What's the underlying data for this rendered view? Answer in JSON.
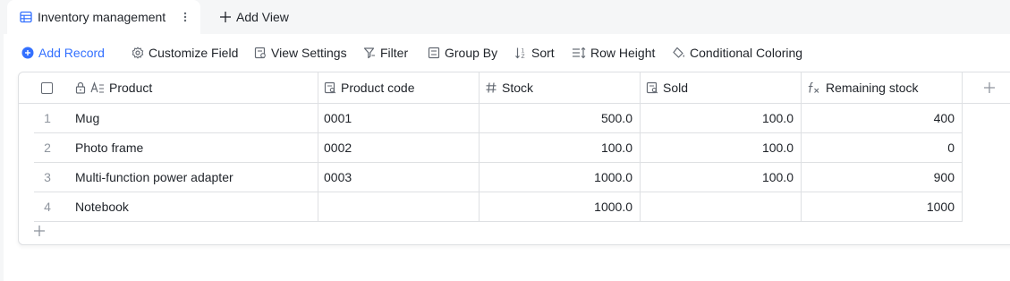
{
  "tabs": {
    "active_label": "Inventory management",
    "add_view_label": "Add View"
  },
  "toolbar": {
    "add_record": "Add Record",
    "customize_field": "Customize Field",
    "view_settings": "View Settings",
    "filter": "Filter",
    "group_by": "Group By",
    "sort": "Sort",
    "row_height": "Row Height",
    "conditional_coloring": "Conditional Coloring"
  },
  "table": {
    "columns": [
      "Product",
      "Product code",
      "Stock",
      "Sold",
      "Remaining stock"
    ],
    "rows": [
      {
        "index": "1",
        "product": "Mug",
        "code": "0001",
        "stock": "500.0",
        "sold": "100.0",
        "remaining": "400"
      },
      {
        "index": "2",
        "product": "Photo frame",
        "code": "0002",
        "stock": "100.0",
        "sold": "100.0",
        "remaining": "0"
      },
      {
        "index": "3",
        "product": "Multi-function power adapter",
        "code": "0003",
        "stock": "1000.0",
        "sold": "100.0",
        "remaining": "900"
      },
      {
        "index": "4",
        "product": "Notebook",
        "code": "",
        "stock": "1000.0",
        "sold": "",
        "remaining": "1000"
      }
    ]
  },
  "colors": {
    "accent": "#3370ff",
    "border": "#dee0e3",
    "muted": "#8f959e",
    "text": "#1f2329"
  },
  "icons": [
    "grid-icon",
    "more-vertical-icon",
    "plus-icon",
    "add-circle-icon",
    "gear-icon",
    "view-settings-icon",
    "filter-icon",
    "group-by-icon",
    "sort-icon",
    "row-height-icon",
    "paint-bucket-icon",
    "lock-icon",
    "text-field-icon",
    "lookup-field-icon",
    "number-field-icon",
    "formula-icon"
  ]
}
